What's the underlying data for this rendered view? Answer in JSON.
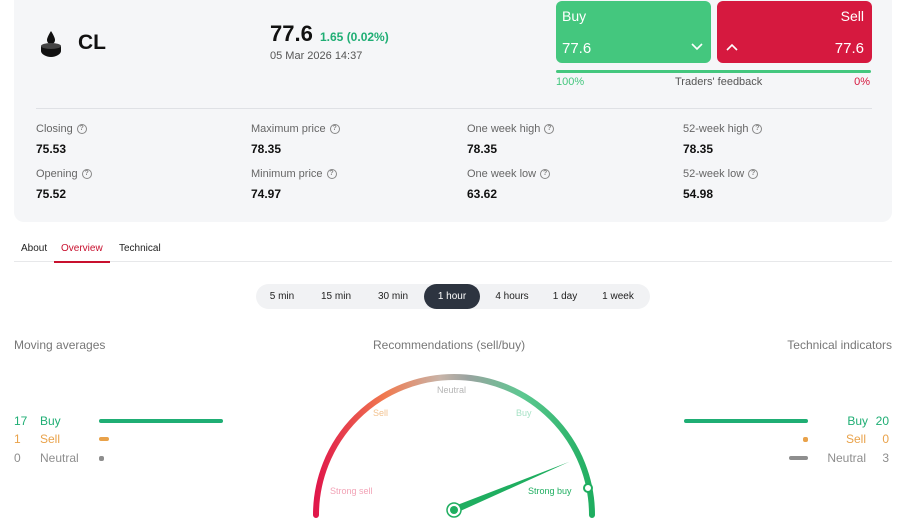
{
  "colors": {
    "buy": "#1fae74",
    "buy_button": "#44c77e",
    "sell": "#e9a24a",
    "sell_button": "#d6193f",
    "neutral": "#8e8e8e"
  },
  "header": {
    "symbol": "CL",
    "symbol_icon": "oil-drop-icon",
    "price": "77.6",
    "change": "1.65 (0.02%)",
    "timestamp": "05 Mar 2026 14:37"
  },
  "trade": {
    "buy_label": "Buy",
    "buy_price": "77.6",
    "sell_label": "Sell",
    "sell_price": "77.6",
    "feedback_buy_pct": "100%",
    "feedback_label": "Traders' feedback",
    "feedback_sell_pct": "0%",
    "feedback_buy_fraction": 1.0
  },
  "stats": [
    {
      "label": "Closing",
      "value": "75.53"
    },
    {
      "label": "Maximum price",
      "value": "78.35"
    },
    {
      "label": "One week high",
      "value": "78.35"
    },
    {
      "label": "52-week high",
      "value": "78.35"
    },
    {
      "label": "Opening",
      "value": "75.52"
    },
    {
      "label": "Minimum price",
      "value": "74.97"
    },
    {
      "label": "One week low",
      "value": "63.62"
    },
    {
      "label": "52-week low",
      "value": "54.98"
    }
  ],
  "tabs": [
    {
      "label": "About"
    },
    {
      "label": "Overview"
    },
    {
      "label": "Technical"
    }
  ],
  "active_tab": "Overview",
  "timeframes": [
    "5 min",
    "15 min",
    "30 min",
    "1 hour",
    "4 hours",
    "1 day",
    "1 week"
  ],
  "active_timeframe": "1 hour",
  "moving_averages": {
    "title": "Moving averages",
    "rows": [
      {
        "count": "17",
        "label": "Buy",
        "value": 17
      },
      {
        "count": "1",
        "label": "Sell",
        "value": 1
      },
      {
        "count": "0",
        "label": "Neutral",
        "value": 0
      }
    ]
  },
  "recommendations": {
    "title": "Recommendations (sell/buy)",
    "labels": {
      "strong_sell": "Strong sell",
      "sell": "Sell",
      "neutral": "Neutral",
      "buy": "Buy",
      "strong_buy": "Strong buy"
    },
    "reading": "Strong buy",
    "needle_fraction": 0.95
  },
  "technical_indicators": {
    "title": "Technical indicators",
    "rows": [
      {
        "count": "20",
        "label": "Buy",
        "value": 20
      },
      {
        "count": "0",
        "label": "Sell",
        "value": 0
      },
      {
        "count": "3",
        "label": "Neutral",
        "value": 3
      }
    ]
  }
}
